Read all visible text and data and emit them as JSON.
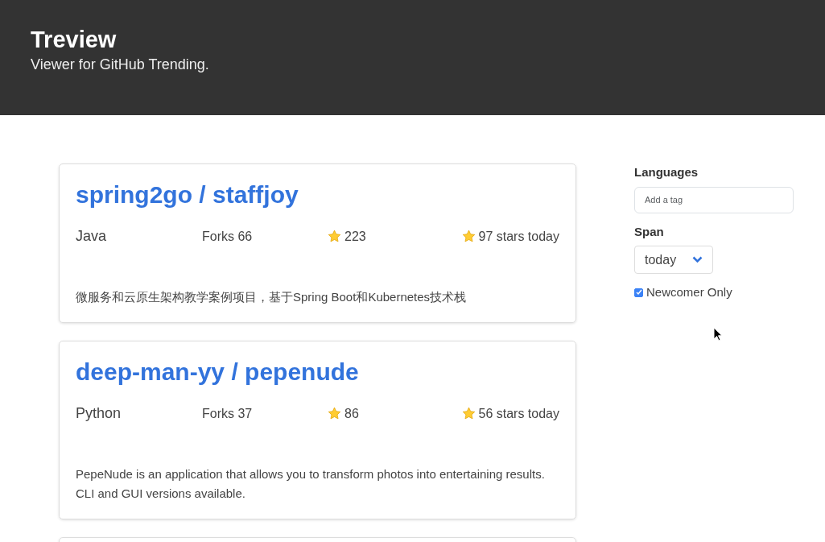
{
  "header": {
    "title": "Treview",
    "subtitle": "Viewer for GitHub Trending."
  },
  "repos": [
    {
      "name": "spring2go / staffjoy",
      "language": "Java",
      "forks": "Forks 66",
      "stars": "223",
      "stars_today": "97 stars today",
      "description": "微服务和云原生架构教学案例项目，基于Spring Boot和Kubernetes技术栈"
    },
    {
      "name": "deep-man-yy / pepenude",
      "language": "Python",
      "forks": "Forks 37",
      "stars": "86",
      "stars_today": "56 stars today",
      "description": "PepeNude is an application that allows you to transform photos into entertaining results. CLI and GUI versions available."
    }
  ],
  "sidebar": {
    "languages_label": "Languages",
    "languages_placeholder": "Add a tag",
    "span_label": "Span",
    "span_value": "today",
    "newcomer": {
      "label": "Newcomer Only",
      "checked": true
    }
  }
}
